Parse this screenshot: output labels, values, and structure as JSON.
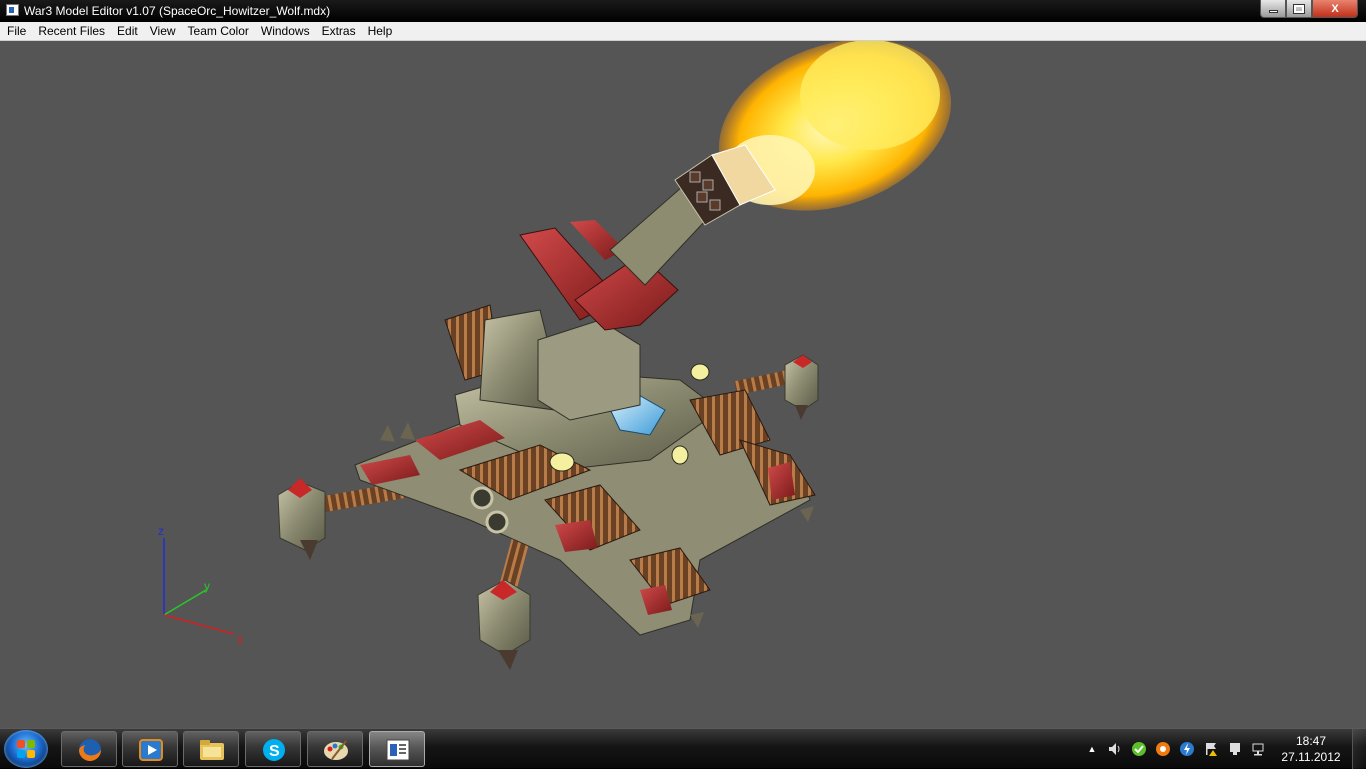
{
  "window": {
    "title": "War3 Model Editor v1.07 (SpaceOrc_Howitzer_Wolf.mdx)",
    "close_label": "X"
  },
  "menu": {
    "items": [
      "File",
      "Recent Files",
      "Edit",
      "View",
      "Team Color",
      "Windows",
      "Extras",
      "Help"
    ]
  },
  "viewport": {
    "background": "#555555",
    "axis_labels": {
      "z": "z",
      "y": "y",
      "x": "x"
    },
    "axis_colors": {
      "z": "#1e2fd6",
      "y": "#28c828",
      "x": "#d42020"
    }
  },
  "taskbar": {
    "pinned": [
      {
        "name": "firefox-icon"
      },
      {
        "name": "media-player-icon"
      },
      {
        "name": "explorer-icon"
      },
      {
        "name": "skype-icon"
      },
      {
        "name": "paint-icon"
      },
      {
        "name": "model-editor-icon",
        "active": true
      }
    ],
    "clock": {
      "time": "18:47",
      "date": "27.11.2012"
    }
  }
}
